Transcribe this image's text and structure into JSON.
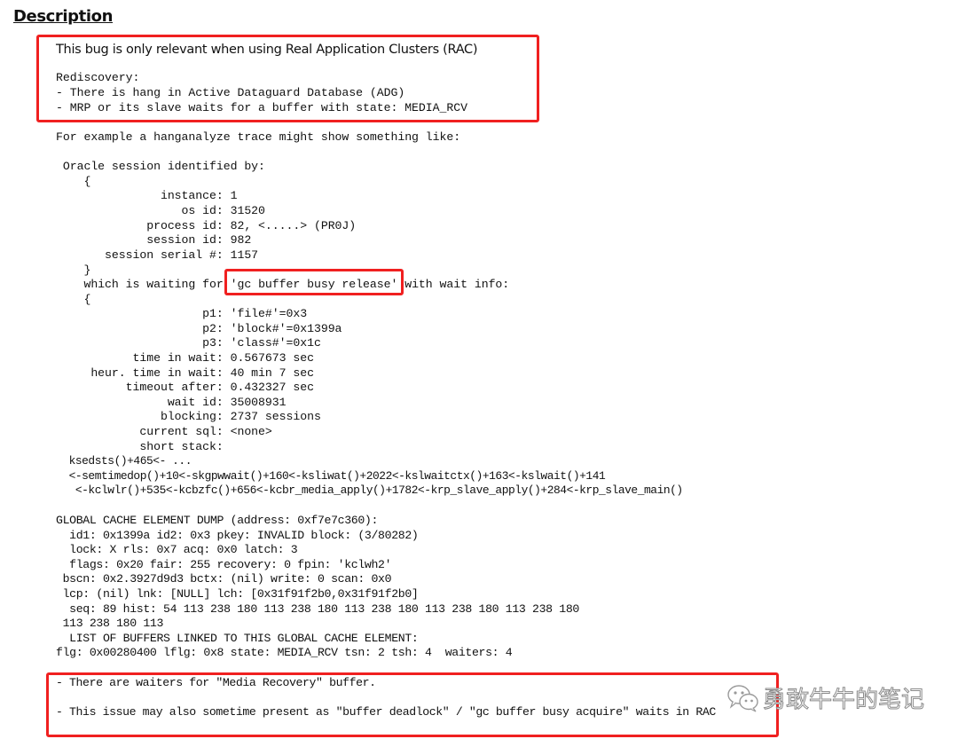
{
  "heading": "Description",
  "intro": {
    "relevance": "This bug is only relevant when using Real Application Clusters (RAC)",
    "rediscovery_label": "Rediscovery:",
    "rediscovery_items": [
      "- There is hang in Active Dataguard Database (ADG)",
      "- MRP or its slave waits for a buffer with state: MEDIA_RCV"
    ]
  },
  "example_intro": "For example a hanganalyze trace might show something like:",
  "trace": {
    "session_header": " Oracle session identified by:",
    "open_brace_1": "    {",
    "session_fields": [
      "               instance: 1",
      "                  os id: 31520",
      "             process id: 82, <.....> (PR0J)",
      "             session id: 982",
      "       session serial #: 1157"
    ],
    "close_brace_1": "    }",
    "waiting_prefix": "    which is waiting for ",
    "waiting_event": "'gc buffer busy release'",
    "waiting_suffix": " with wait info:",
    "open_brace_2": "    {",
    "wait_fields": [
      "                     p1: 'file#'=0x3",
      "                     p2: 'block#'=0x1399a",
      "                     p3: 'class#'=0x1c",
      "           time in wait: 0.567673 sec",
      "     heur. time in wait: 40 min 7 sec",
      "          timeout after: 0.432327 sec",
      "                wait id: 35008931",
      "               blocking: 2737 sessions",
      "            current sql: <none>",
      "            short stack:"
    ],
    "stack_lines": [
      "  ksedsts()+465<- ...",
      "  <-semtimedop()+10<-skgpwwait()+160<-ksliwat()+2022<-kslwaitctx()+163<-kslwait()+141",
      "   <-kclwlr()+535<-kcbzfc()+656<-kcbr_media_apply()+1782<-krp_slave_apply()+284<-krp_slave_main()"
    ]
  },
  "gc_dump": [
    "GLOBAL CACHE ELEMENT DUMP (address: 0xf7e7c360):",
    "  id1: 0x1399a id2: 0x3 pkey: INVALID block: (3/80282)",
    "  lock: X rls: 0x7 acq: 0x0 latch: 3",
    "  flags: 0x20 fair: 255 recovery: 0 fpin: 'kclwh2'",
    " bscn: 0x2.3927d9d3 bctx: (nil) write: 0 scan: 0x0",
    " lcp: (nil) lnk: [NULL] lch: [0x31f91f2b0,0x31f91f2b0]",
    "  seq: 89 hist: 54 113 238 180 113 238 180 113 238 180 113 238 180 113 238 180",
    " 113 238 180 113",
    "  LIST OF BUFFERS LINKED TO THIS GLOBAL CACHE ELEMENT:",
    "flg: 0x00280400 lflg: 0x8 state: MEDIA_RCV tsn: 2 tsh: 4  waiters: 4"
  ],
  "notes": [
    "- There are waiters for \"Media Recovery\" buffer.",
    "- This issue may also sometime present as \"buffer deadlock\" / \"gc buffer busy acquire\" waits in RAC"
  ],
  "watermark": {
    "icon": "wechat-icon",
    "text": "勇敢牛牛的笔记"
  },
  "colors": {
    "highlight_border": "#f02020",
    "text": "#111111"
  }
}
